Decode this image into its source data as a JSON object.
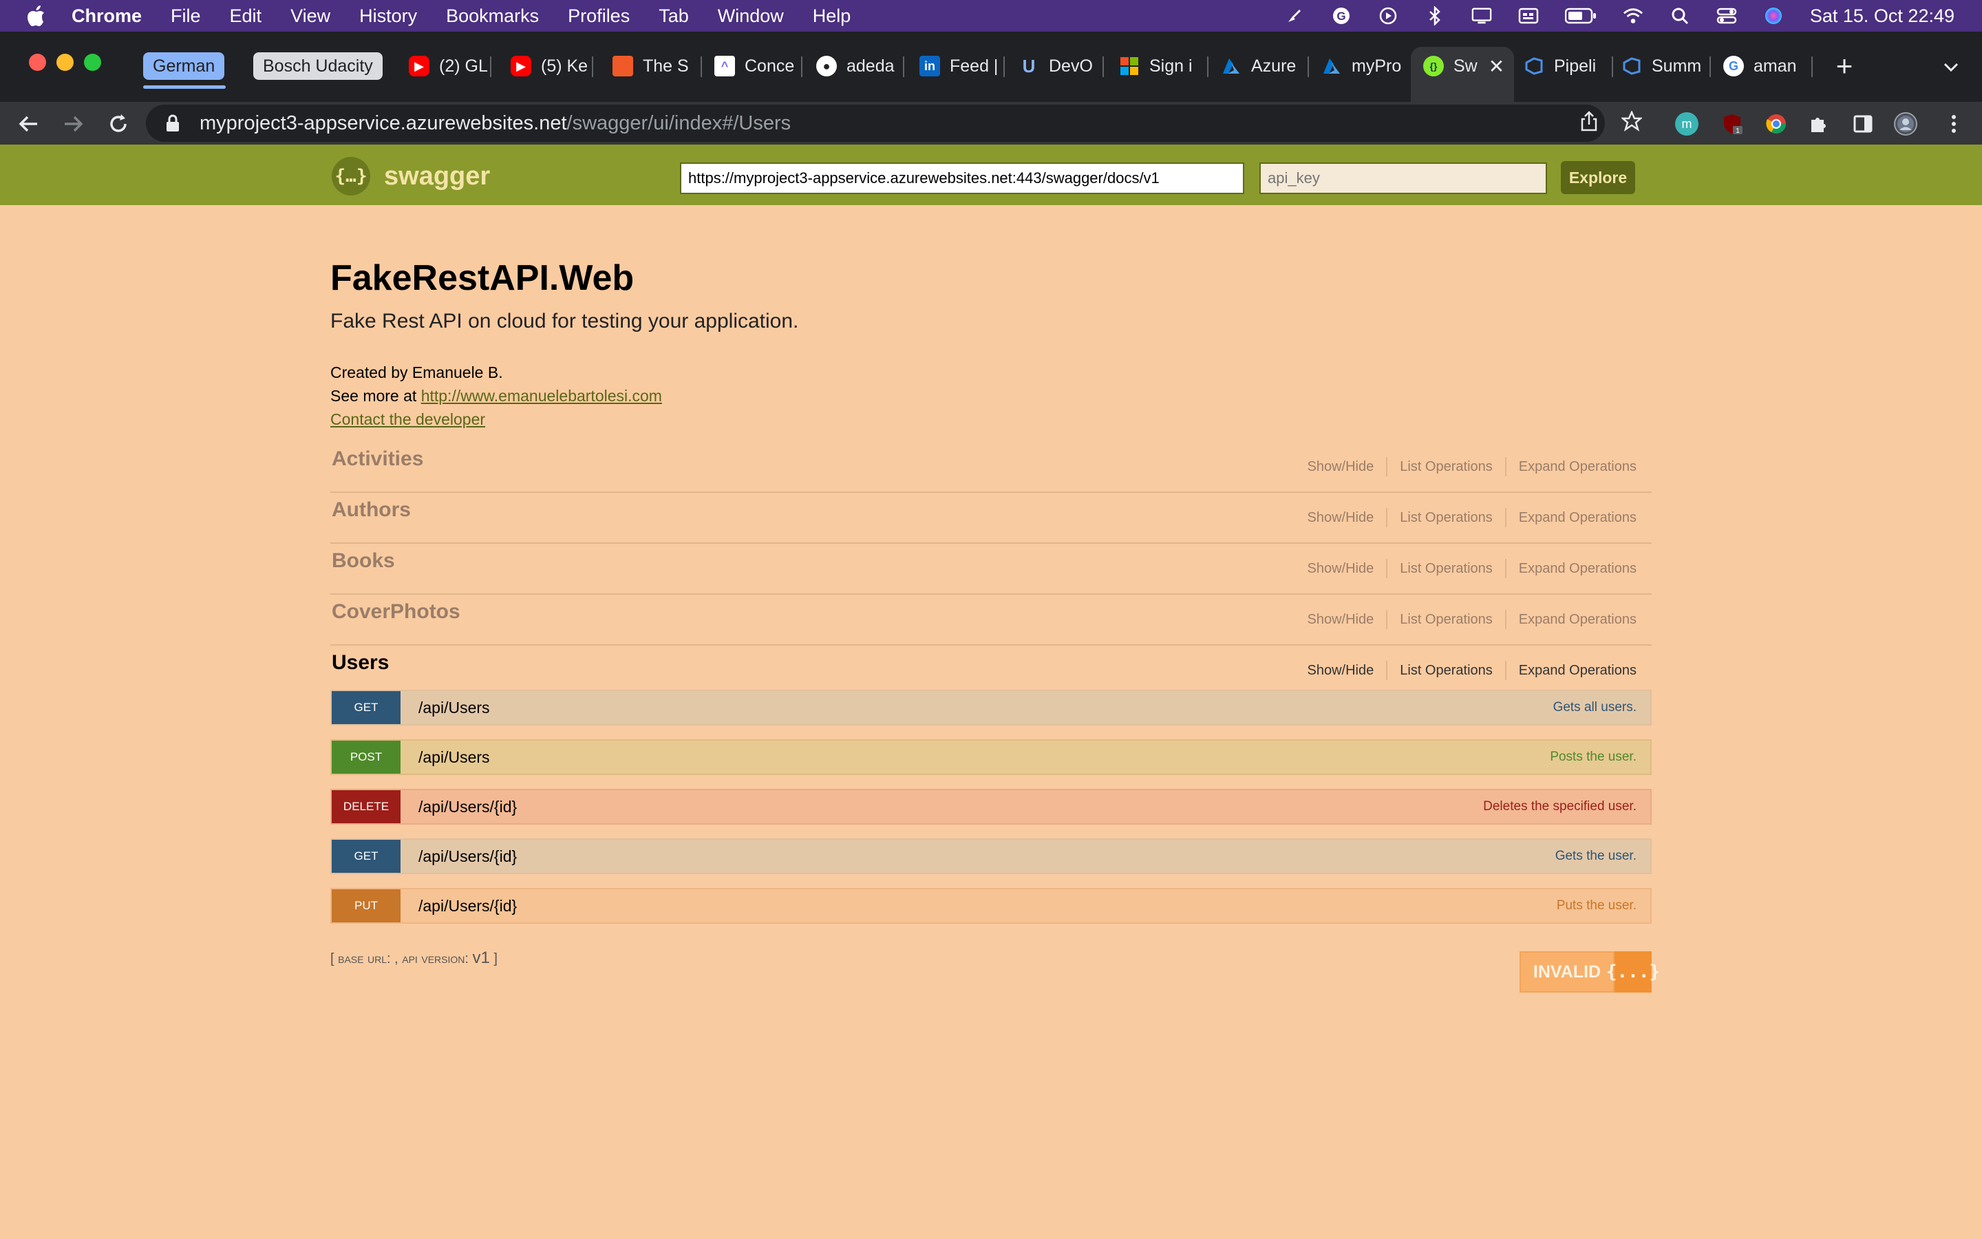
{
  "menubar": {
    "app_name": "Chrome",
    "items": [
      "File",
      "Edit",
      "View",
      "History",
      "Bookmarks",
      "Profiles",
      "Tab",
      "Window",
      "Help"
    ],
    "clock": "Sat 15. Oct  22:49"
  },
  "tabs": {
    "groups": [
      {
        "label": "German",
        "color": "#8ab4f8"
      },
      {
        "label": "Bosch Udacity",
        "color": "#dadce0"
      }
    ],
    "items": [
      {
        "title": "(2) GL",
        "icon": "youtube-icon"
      },
      {
        "title": "(5) Ke",
        "icon": "youtube-icon"
      },
      {
        "title": "The S",
        "icon": "orange-site-icon"
      },
      {
        "title": "Conce",
        "icon": "clickup-icon"
      },
      {
        "title": "adeda",
        "icon": "github-icon"
      },
      {
        "title": "Feed |",
        "icon": "linkedin-icon"
      },
      {
        "title": "DevO",
        "icon": "udacity-icon"
      },
      {
        "title": "Sign i",
        "icon": "microsoft-icon"
      },
      {
        "title": "Azure",
        "icon": "azure-icon"
      },
      {
        "title": "myPro",
        "icon": "azure-icon"
      },
      {
        "title": "Sw",
        "icon": "swagger-icon",
        "active": true
      },
      {
        "title": "Pipeli",
        "icon": "azure-devops-icon"
      },
      {
        "title": "Summ",
        "icon": "azure-devops-icon"
      },
      {
        "title": "aman",
        "icon": "google-icon"
      }
    ]
  },
  "address_bar": {
    "host": "myproject3-appservice.azurewebsites.net",
    "path": "/swagger/ui/index#/Users"
  },
  "swagger_header": {
    "logo_text": "swagger",
    "spec_url": "https://myproject3-appservice.azurewebsites.net:443/swagger/docs/v1",
    "api_key_placeholder": "api_key",
    "explore_label": "Explore"
  },
  "info": {
    "title": "FakeRestAPI.Web",
    "description": "Fake Rest API on cloud for testing your application.",
    "created_by": "Created by Emanuele B.",
    "see_more_prefix": "See more at ",
    "see_more_link": "http://www.emanuelebartolesi.com",
    "contact_link": "Contact the developer"
  },
  "resources": [
    {
      "name": "Activities",
      "show_hide": "Show/Hide",
      "list_ops": "List Operations",
      "expand_ops": "Expand Operations"
    },
    {
      "name": "Authors",
      "show_hide": "Show/Hide",
      "list_ops": "List Operations",
      "expand_ops": "Expand Operations"
    },
    {
      "name": "Books",
      "show_hide": "Show/Hide",
      "list_ops": "List Operations",
      "expand_ops": "Expand Operations"
    },
    {
      "name": "CoverPhotos",
      "show_hide": "Show/Hide",
      "list_ops": "List Operations",
      "expand_ops": "Expand Operations"
    },
    {
      "name": "Users",
      "show_hide": "Show/Hide",
      "list_ops": "List Operations",
      "expand_ops": "Expand Operations",
      "expanded": true
    }
  ],
  "endpoints": [
    {
      "method": "GET",
      "path": "/api/Users",
      "summary": "Gets all users."
    },
    {
      "method": "POST",
      "path": "/api/Users",
      "summary": "Posts the user."
    },
    {
      "method": "DELETE",
      "path": "/api/Users/{id}",
      "summary": "Deletes the specified user."
    },
    {
      "method": "GET",
      "path": "/api/Users/{id}",
      "summary": "Gets the user."
    },
    {
      "method": "PUT",
      "path": "/api/Users/{id}",
      "summary": "Puts the user."
    }
  ],
  "footer": {
    "base_url_text": "[ base url: , api version: ",
    "api_version": "v1",
    "close_bracket": " ]",
    "validator_text": "INVALID",
    "validator_logo": "{...}"
  },
  "colors": {
    "page_bg": "#f9cba1",
    "header_bg": "#8a9a2c",
    "get": "#2e5677",
    "post": "#4f8a2a",
    "delete": "#9d1e18",
    "put": "#c7762a"
  }
}
